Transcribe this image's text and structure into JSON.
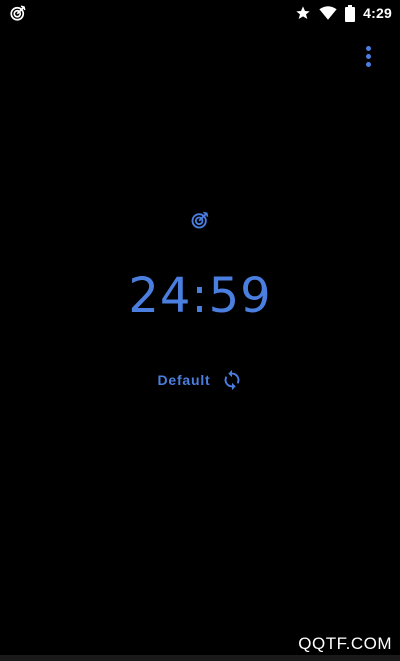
{
  "status_bar": {
    "time": "4:29",
    "icons": [
      "target-notification-icon",
      "star-icon",
      "wifi-icon",
      "battery-icon"
    ]
  },
  "toolbar": {
    "overflow_icon": "more-vert-icon"
  },
  "timer": {
    "icon": "target-icon",
    "time": "24:59",
    "preset_label": "Default",
    "reset_icon": "refresh-icon"
  },
  "watermark": {
    "text": "QQTF.COM"
  },
  "colors": {
    "background": "#000000",
    "accent": "#4a7fe0",
    "status_text": "#ffffff"
  }
}
